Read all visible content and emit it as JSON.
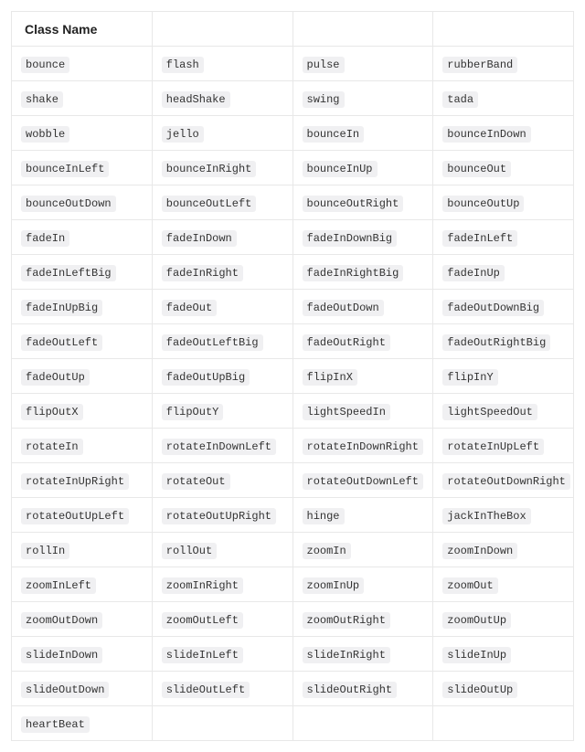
{
  "table": {
    "headers": [
      "Class Name",
      "",
      "",
      ""
    ],
    "rows": [
      [
        "bounce",
        "flash",
        "pulse",
        "rubberBand"
      ],
      [
        "shake",
        "headShake",
        "swing",
        "tada"
      ],
      [
        "wobble",
        "jello",
        "bounceIn",
        "bounceInDown"
      ],
      [
        "bounceInLeft",
        "bounceInRight",
        "bounceInUp",
        "bounceOut"
      ],
      [
        "bounceOutDown",
        "bounceOutLeft",
        "bounceOutRight",
        "bounceOutUp"
      ],
      [
        "fadeIn",
        "fadeInDown",
        "fadeInDownBig",
        "fadeInLeft"
      ],
      [
        "fadeInLeftBig",
        "fadeInRight",
        "fadeInRightBig",
        "fadeInUp"
      ],
      [
        "fadeInUpBig",
        "fadeOut",
        "fadeOutDown",
        "fadeOutDownBig"
      ],
      [
        "fadeOutLeft",
        "fadeOutLeftBig",
        "fadeOutRight",
        "fadeOutRightBig"
      ],
      [
        "fadeOutUp",
        "fadeOutUpBig",
        "flipInX",
        "flipInY"
      ],
      [
        "flipOutX",
        "flipOutY",
        "lightSpeedIn",
        "lightSpeedOut"
      ],
      [
        "rotateIn",
        "rotateInDownLeft",
        "rotateInDownRight",
        "rotateInUpLeft"
      ],
      [
        "rotateInUpRight",
        "rotateOut",
        "rotateOutDownLeft",
        "rotateOutDownRight"
      ],
      [
        "rotateOutUpLeft",
        "rotateOutUpRight",
        "hinge",
        "jackInTheBox"
      ],
      [
        "rollIn",
        "rollOut",
        "zoomIn",
        "zoomInDown"
      ],
      [
        "zoomInLeft",
        "zoomInRight",
        "zoomInUp",
        "zoomOut"
      ],
      [
        "zoomOutDown",
        "zoomOutLeft",
        "zoomOutRight",
        "zoomOutUp"
      ],
      [
        "slideInDown",
        "slideInLeft",
        "slideInRight",
        "slideInUp"
      ],
      [
        "slideOutDown",
        "slideOutLeft",
        "slideOutRight",
        "slideOutUp"
      ],
      [
        "heartBeat",
        "",
        "",
        ""
      ]
    ]
  }
}
